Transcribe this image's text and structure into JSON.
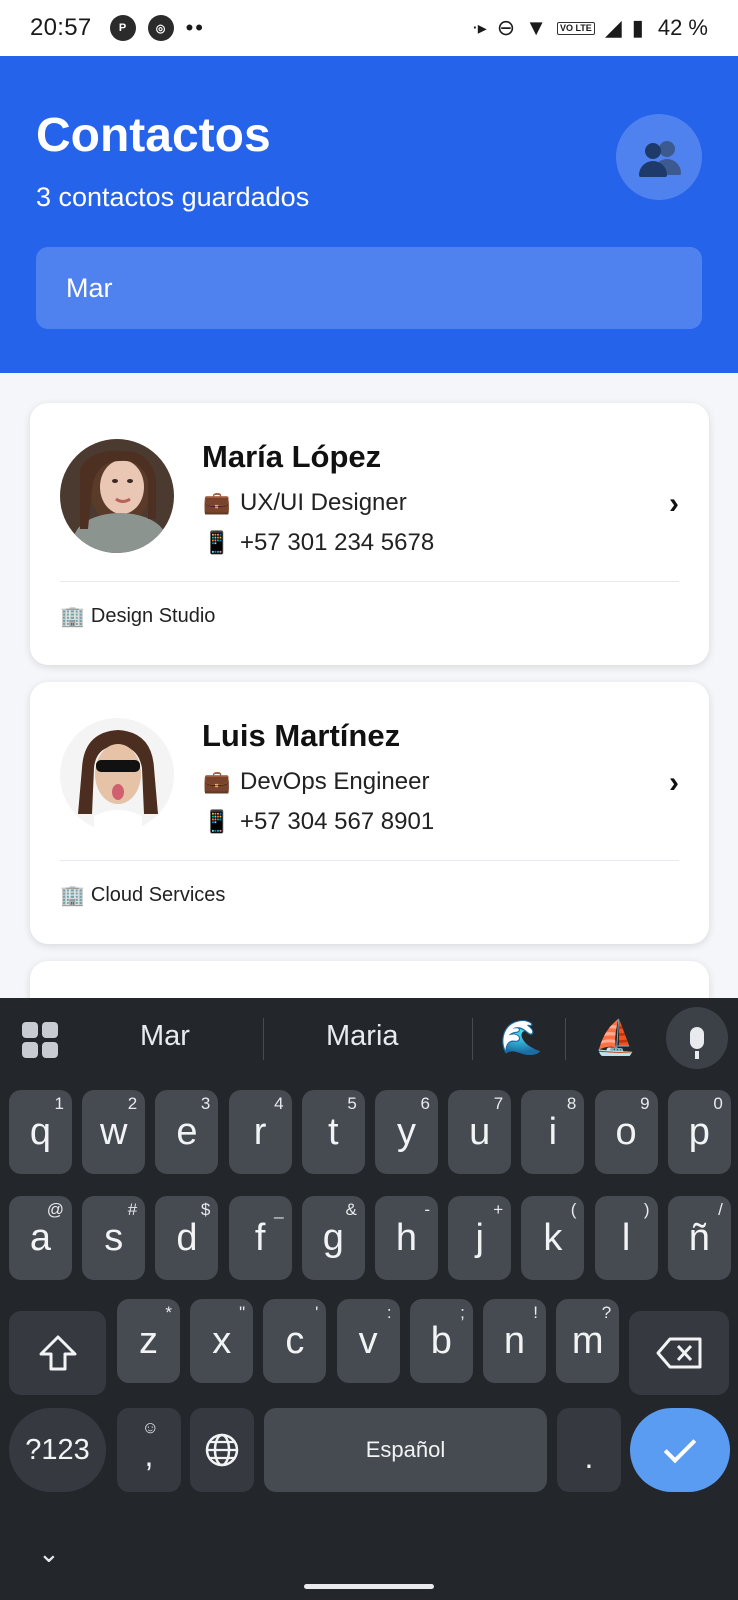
{
  "status_bar": {
    "time": "20:57",
    "battery": "42 %",
    "volte": "VO LTE",
    "icons": [
      "app-p-icon",
      "app-circle-icon",
      "more-dots-icon",
      "dnd-icon",
      "wifi-icon",
      "signal-icon",
      "battery-icon"
    ]
  },
  "header": {
    "title": "Contactos",
    "subtitle": "3 contactos guardados",
    "search_value": "Mar",
    "icon": "people-icon",
    "bg_color": "#2563eb"
  },
  "contacts": [
    {
      "name": "María López",
      "role": "UX/UI Designer",
      "phone": "+57 301 234 5678",
      "company": "Design Studio",
      "role_icon": "💼",
      "phone_icon": "📱",
      "company_icon": "🏢"
    },
    {
      "name": "Luis Martínez",
      "role": "DevOps Engineer",
      "phone": "+57 304 567 8901",
      "company": "Cloud Services",
      "role_icon": "💼",
      "phone_icon": "📱",
      "company_icon": "🏢"
    }
  ],
  "keyboard": {
    "suggestions": [
      "Mar",
      "Maria"
    ],
    "emoji_suggestions": [
      "🌊",
      "⛵"
    ],
    "row1": [
      {
        "k": "q",
        "h": "1"
      },
      {
        "k": "w",
        "h": "2"
      },
      {
        "k": "e",
        "h": "3"
      },
      {
        "k": "r",
        "h": "4"
      },
      {
        "k": "t",
        "h": "5"
      },
      {
        "k": "y",
        "h": "6"
      },
      {
        "k": "u",
        "h": "7"
      },
      {
        "k": "i",
        "h": "8"
      },
      {
        "k": "o",
        "h": "9"
      },
      {
        "k": "p",
        "h": "0"
      }
    ],
    "row2": [
      {
        "k": "a",
        "h": "@"
      },
      {
        "k": "s",
        "h": "#"
      },
      {
        "k": "d",
        "h": "$"
      },
      {
        "k": "f",
        "h": "_"
      },
      {
        "k": "g",
        "h": "&"
      },
      {
        "k": "h",
        "h": "-"
      },
      {
        "k": "j",
        "h": "+"
      },
      {
        "k": "k",
        "h": "("
      },
      {
        "k": "l",
        "h": ")"
      },
      {
        "k": "ñ",
        "h": "/"
      }
    ],
    "row3": [
      {
        "k": "z",
        "h": "*"
      },
      {
        "k": "x",
        "h": "\""
      },
      {
        "k": "c",
        "h": "'"
      },
      {
        "k": "v",
        "h": ":"
      },
      {
        "k": "b",
        "h": ";"
      },
      {
        "k": "n",
        "h": "!"
      },
      {
        "k": "m",
        "h": "?"
      }
    ],
    "symbols_key": "?123",
    "comma_key": ",",
    "space_label": "Español",
    "period_key": ".",
    "shift_icon": "shift-icon",
    "backspace_icon": "backspace-icon",
    "globe_icon": "globe-icon",
    "enter_icon": "check-icon",
    "accent_color": "#5b9cf3"
  }
}
